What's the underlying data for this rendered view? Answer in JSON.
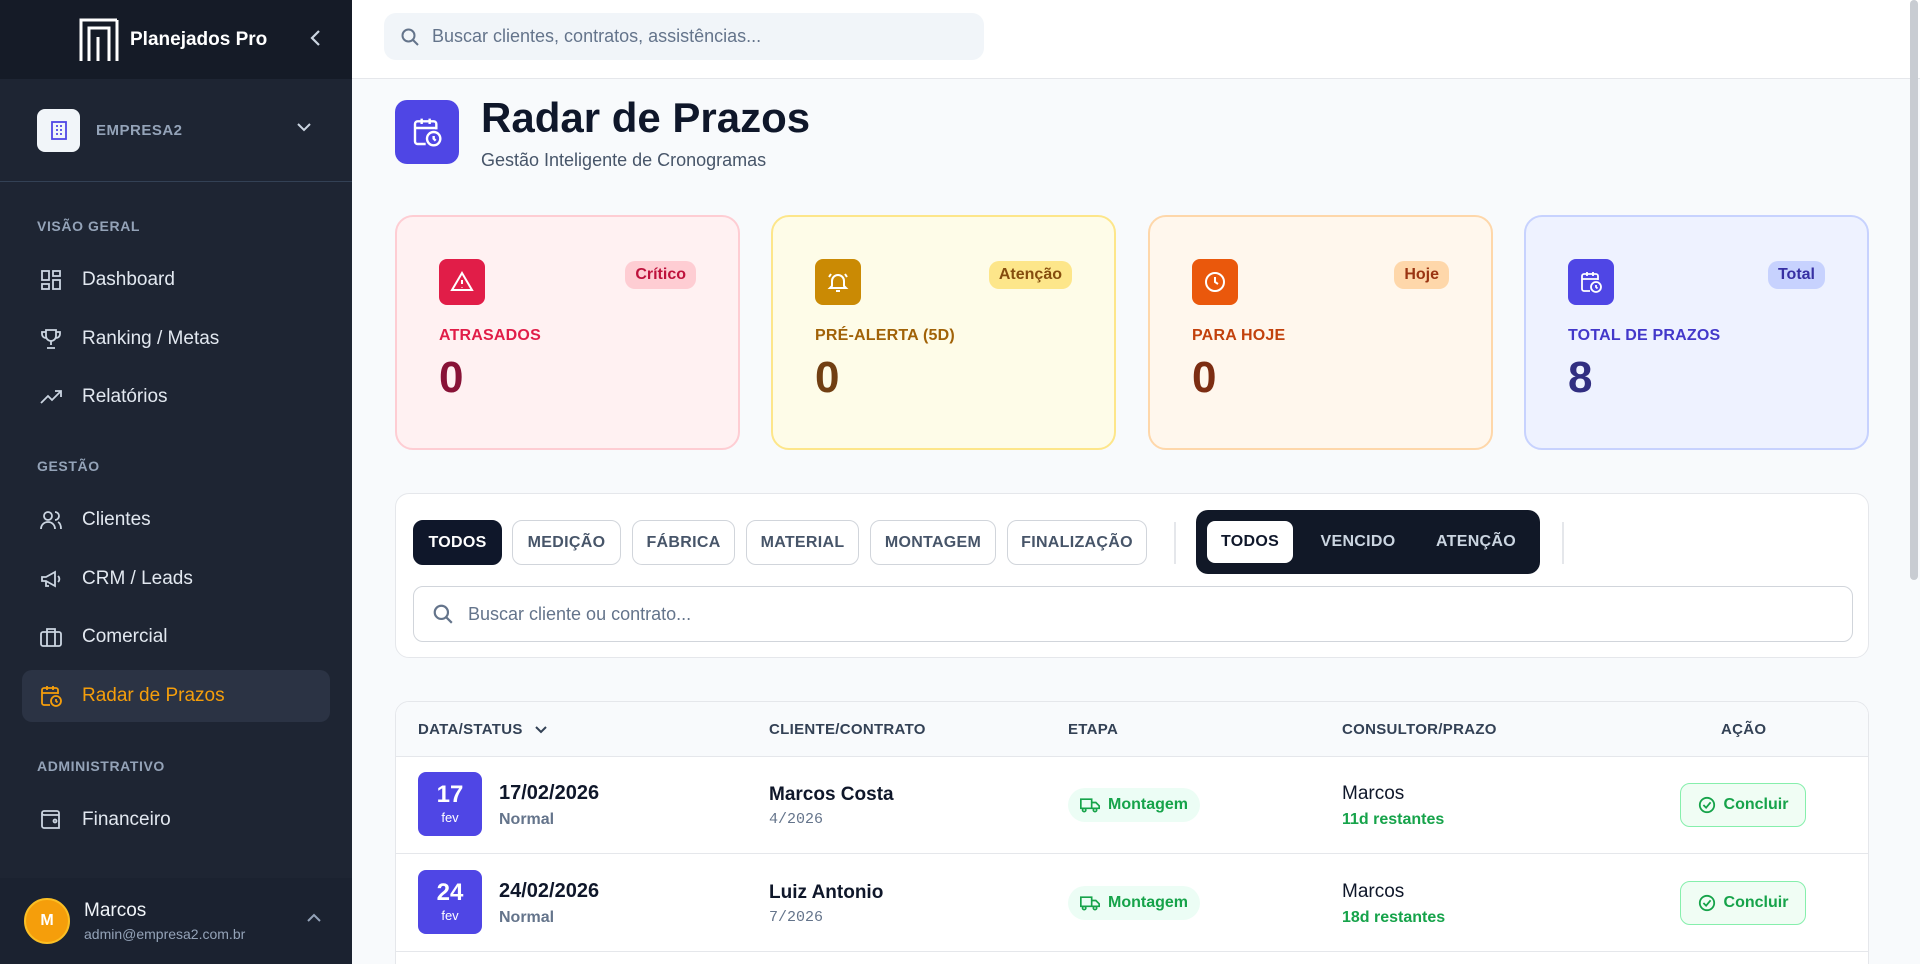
{
  "app": {
    "title": "Planejados Pro"
  },
  "company": {
    "name": "EMPRESA2"
  },
  "sidebar": {
    "sections": [
      {
        "label": "VISÃO GERAL"
      },
      {
        "label": "GESTÃO"
      },
      {
        "label": "ADMINISTRATIVO"
      }
    ],
    "items": [
      {
        "label": "Dashboard",
        "icon": "dashboard-icon"
      },
      {
        "label": "Ranking / Metas",
        "icon": "trophy-icon"
      },
      {
        "label": "Relatórios",
        "icon": "trending-icon"
      },
      {
        "label": "Clientes",
        "icon": "users-icon"
      },
      {
        "label": "CRM / Leads",
        "icon": "megaphone-icon"
      },
      {
        "label": "Comercial",
        "icon": "briefcase-icon"
      },
      {
        "label": "Radar de Prazos",
        "icon": "calendar-clock-icon"
      },
      {
        "label": "Financeiro",
        "icon": "wallet-icon"
      }
    ]
  },
  "user": {
    "initial": "M",
    "name": "Marcos",
    "email": "admin@empresa2.com.br"
  },
  "search": {
    "placeholder": "Buscar clientes, contratos, assistências..."
  },
  "page": {
    "title": "Radar de Prazos",
    "subtitle": "Gestão Inteligente de Cronogramas"
  },
  "cards": [
    {
      "badge": "Crítico",
      "label": "ATRASADOS",
      "value": "0",
      "color": "#e11d48"
    },
    {
      "badge": "Atenção",
      "label": "PRÉ-ALERTA (5D)",
      "value": "0",
      "color": "#ca8a04"
    },
    {
      "badge": "Hoje",
      "label": "PARA HOJE",
      "value": "0",
      "color": "#ea580c"
    },
    {
      "badge": "Total",
      "label": "TOTAL DE PRAZOS",
      "value": "8",
      "color": "#4f46e5"
    }
  ],
  "filters": {
    "stages": [
      "TODOS",
      "MEDIÇÃO",
      "FÁBRICA",
      "MATERIAL",
      "MONTAGEM",
      "FINALIZAÇÃO"
    ],
    "status": [
      "TODOS",
      "VENCIDO",
      "ATENÇÃO"
    ],
    "search_placeholder": "Buscar cliente ou contrato..."
  },
  "table": {
    "headers": [
      "DATA/STATUS",
      "CLIENTE/CONTRATO",
      "ETAPA",
      "CONSULTOR/PRAZO",
      "AÇÃO"
    ],
    "rows": [
      {
        "day": "17",
        "month": "fev",
        "date": "17/02/2026",
        "status": "Normal",
        "client": "Marcos Costa",
        "contract": "4/2026",
        "stage": "Montagem",
        "consultant": "Marcos",
        "remaining": "11d restantes",
        "action": "Concluir"
      },
      {
        "day": "24",
        "month": "fev",
        "date": "24/02/2026",
        "status": "Normal",
        "client": "Luiz Antonio",
        "contract": "7/2026",
        "stage": "Montagem",
        "consultant": "Marcos",
        "remaining": "18d restantes",
        "action": "Concluir"
      }
    ]
  }
}
